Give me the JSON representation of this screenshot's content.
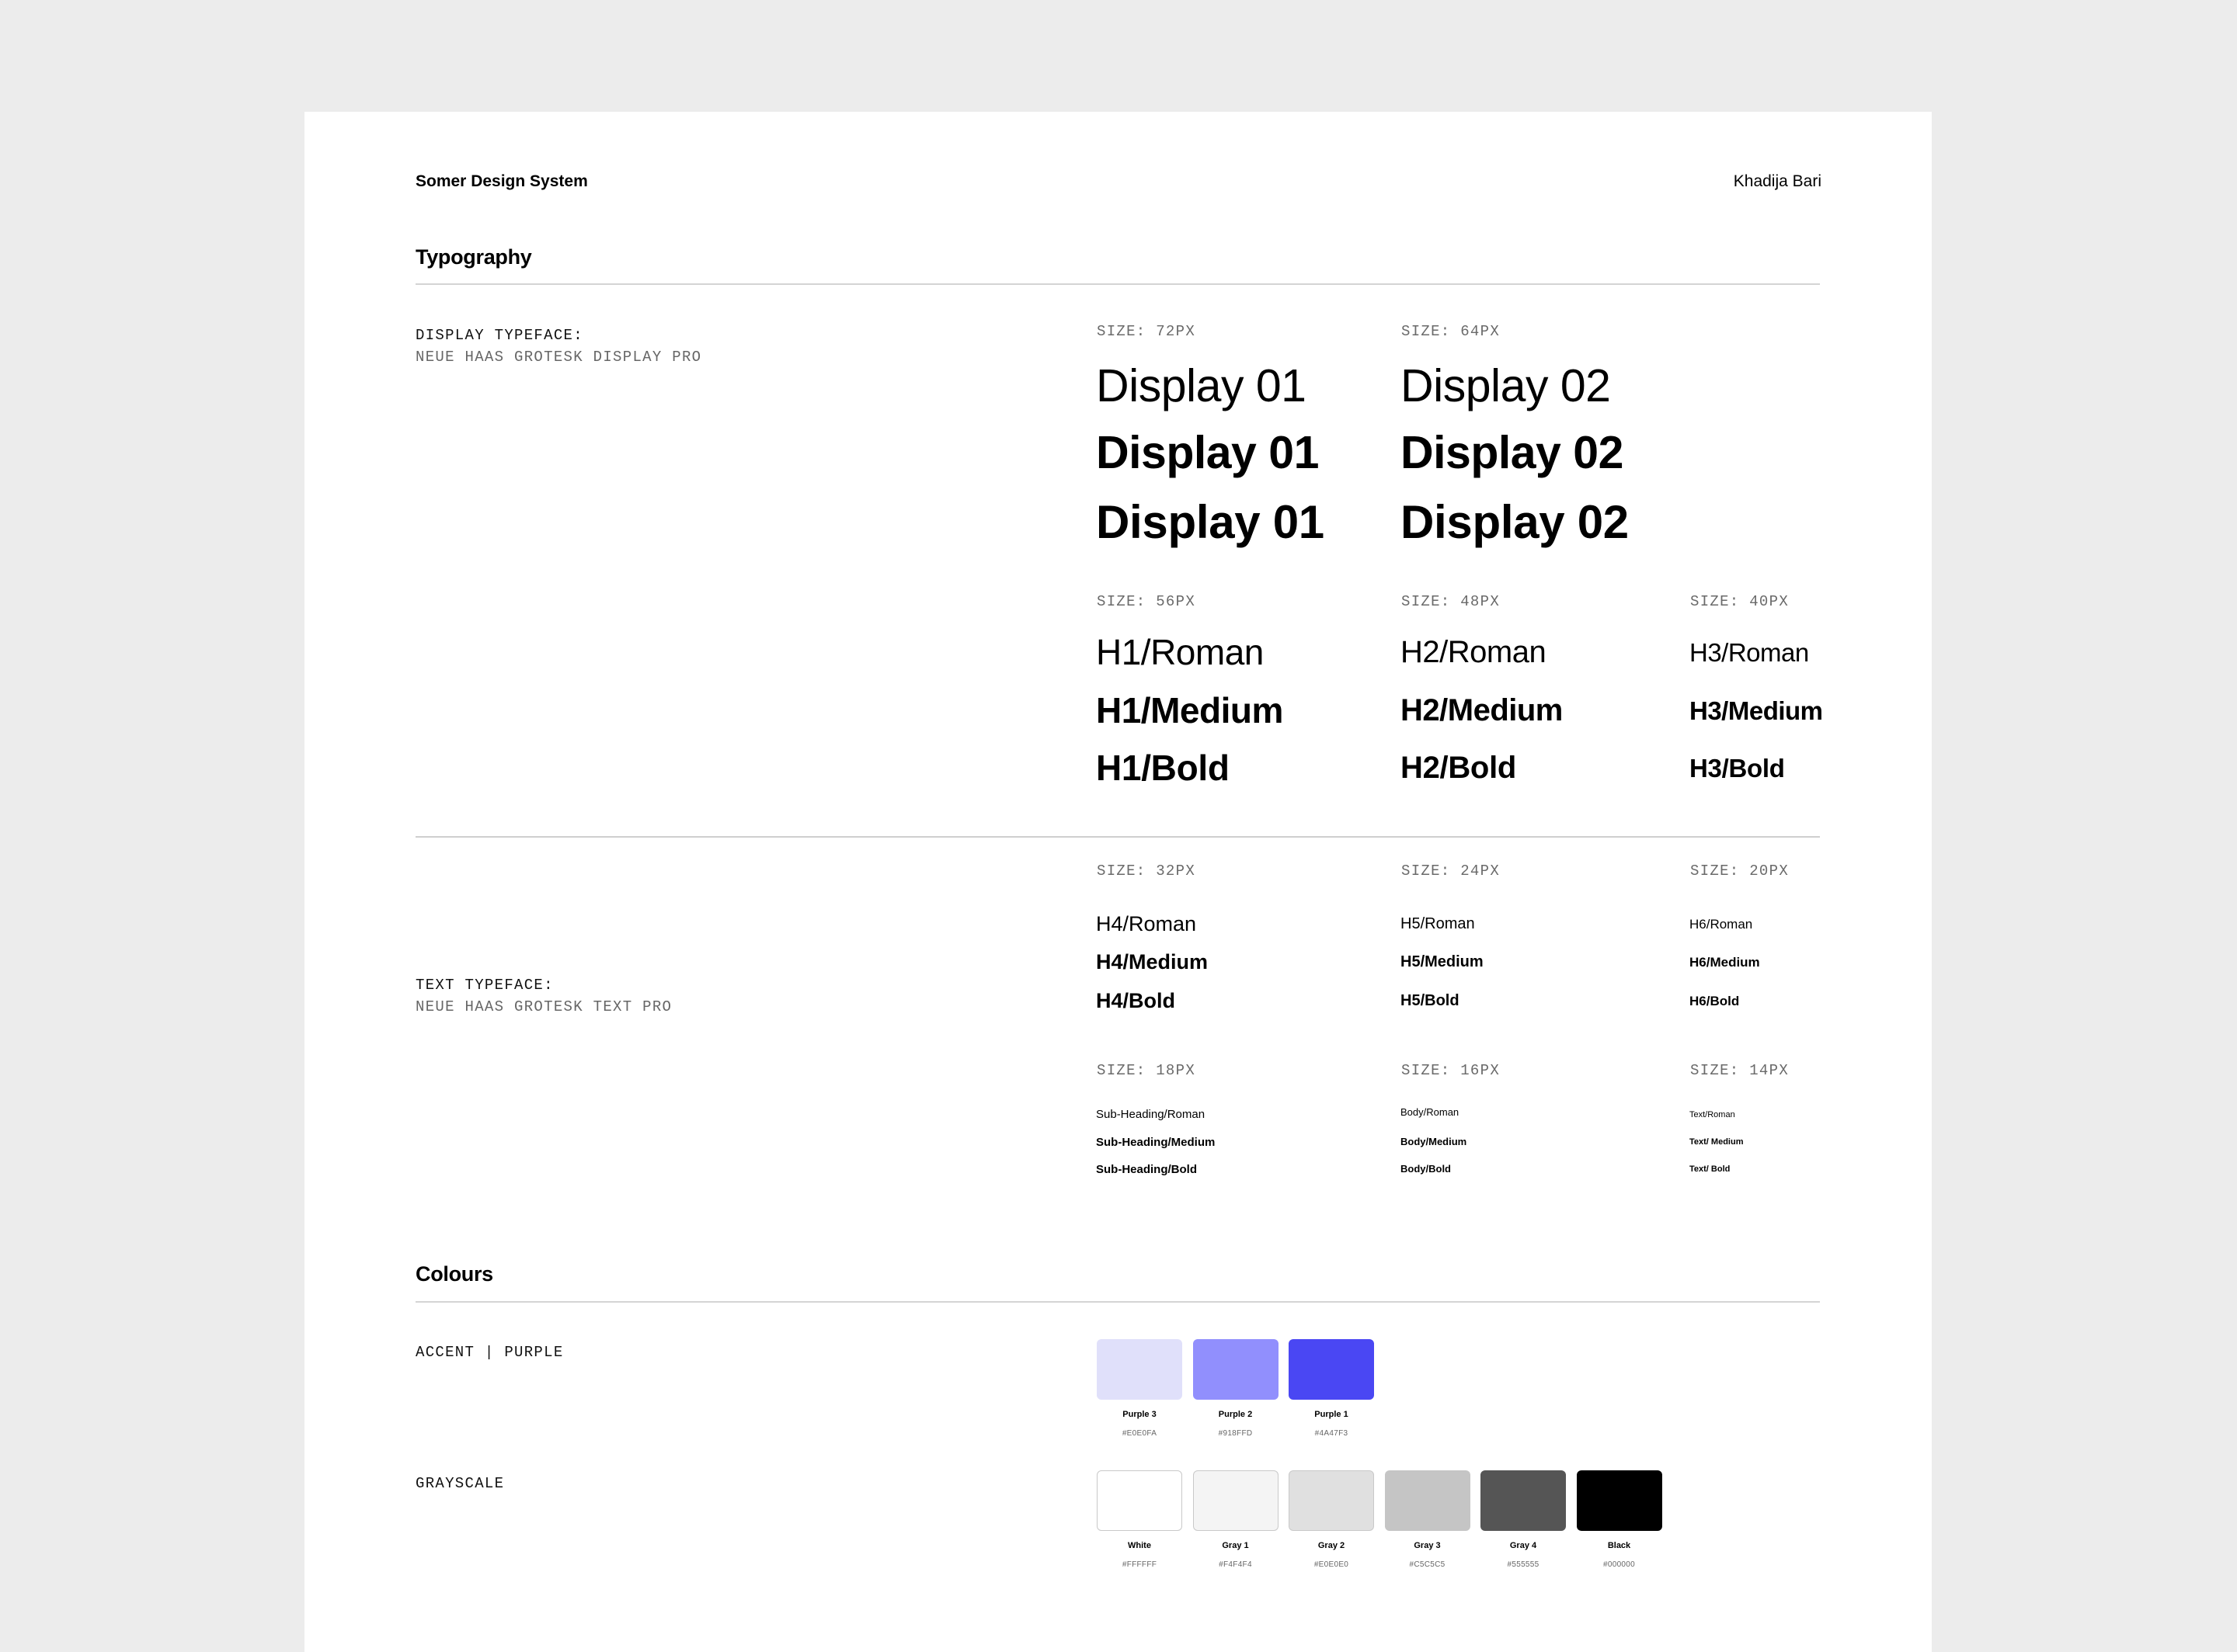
{
  "header": {
    "system_name": "Somer Design System",
    "author": "Khadija Bari"
  },
  "typography": {
    "title": "Typography",
    "display": {
      "label": "DISPLAY TYPEFACE:",
      "typeface": "NEUE HAAS GROTESK DISPLAY PRO",
      "columns": [
        {
          "size": "SIZE: 72PX",
          "samples": [
            "Display 01",
            "Display 01",
            "Display 01"
          ]
        },
        {
          "size": "SIZE: 64PX",
          "samples": [
            "Display 02",
            "Display 02",
            "Display 02"
          ]
        }
      ]
    },
    "headings": [
      {
        "size": "SIZE: 56PX",
        "samples": [
          "H1/Roman",
          "H1/Medium",
          "H1/Bold"
        ]
      },
      {
        "size": "SIZE: 48PX",
        "samples": [
          "H2/Roman",
          "H2/Medium",
          "H2/Bold"
        ]
      },
      {
        "size": "SIZE: 40PX",
        "samples": [
          "H3/Roman",
          "H3/Medium",
          "H3/Bold"
        ]
      }
    ],
    "text": {
      "label": "TEXT TYPEFACE:",
      "typeface": "NEUE HAAS GROTESK TEXT PRO",
      "rows": [
        [
          {
            "size": "SIZE: 32PX",
            "samples": [
              "H4/Roman",
              "H4/Medium",
              "H4/Bold"
            ]
          },
          {
            "size": "SIZE: 24PX",
            "samples": [
              "H5/Roman",
              "H5/Medium",
              "H5/Bold"
            ]
          },
          {
            "size": "SIZE: 20PX",
            "samples": [
              "H6/Roman",
              "H6/Medium",
              "H6/Bold"
            ]
          }
        ],
        [
          {
            "size": "SIZE: 18PX",
            "samples": [
              "Sub-Heading/Roman",
              "Sub-Heading/Medium",
              "Sub-Heading/Bold"
            ]
          },
          {
            "size": "SIZE: 16PX",
            "samples": [
              "Body/Roman",
              "Body/Medium",
              "Body/Bold"
            ]
          },
          {
            "size": "SIZE: 14PX",
            "samples": [
              "Text/Roman",
              "Text/ Medium",
              "Text/ Bold"
            ]
          }
        ]
      ]
    }
  },
  "colours": {
    "title": "Colours",
    "accent": {
      "label": "ACCENT | PURPLE",
      "swatches": [
        {
          "name": "Purple 3",
          "hex": "#E0E0FA",
          "color": "#E0E0FA"
        },
        {
          "name": "Purple 2",
          "hex": "#918FFD",
          "color": "#918FFD"
        },
        {
          "name": "Purple 1",
          "hex": "#4A47F3",
          "color": "#4A47F3"
        }
      ]
    },
    "grayscale": {
      "label": "GRAYSCALE",
      "swatches": [
        {
          "name": "White",
          "hex": "#FFFFFF",
          "color": "#FFFFFF"
        },
        {
          "name": "Gray 1",
          "hex": "#F4F4F4",
          "color": "#F4F4F4"
        },
        {
          "name": "Gray 2",
          "hex": "#E0E0E0",
          "color": "#E0E0E0"
        },
        {
          "name": "Gray 3",
          "hex": "#C5C5C5",
          "color": "#C5C5C5"
        },
        {
          "name": "Gray 4",
          "hex": "#555555",
          "color": "#555555"
        },
        {
          "name": "Black",
          "hex": "#000000",
          "color": "#000000"
        }
      ]
    }
  }
}
